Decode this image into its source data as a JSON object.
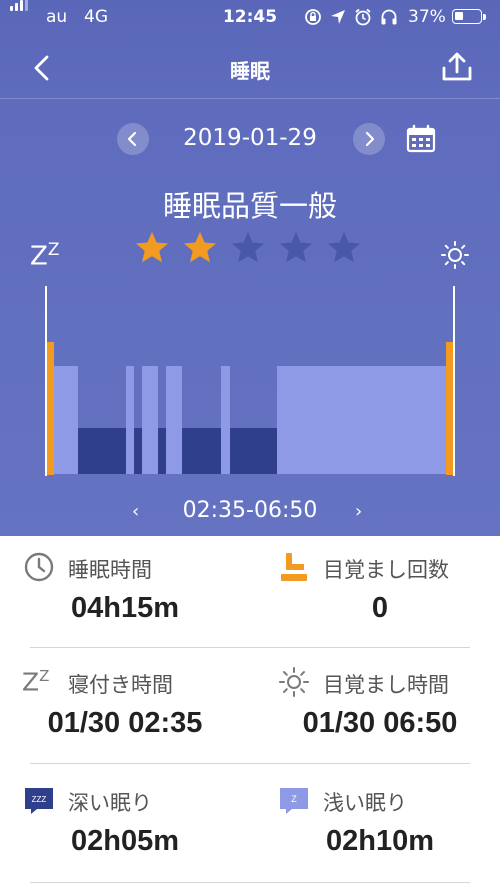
{
  "status_bar": {
    "carrier": "au",
    "network": "4G",
    "time": "12:45",
    "battery_percent": "37%",
    "battery_level": 0.37
  },
  "nav": {
    "title": "睡眠"
  },
  "date_bar": {
    "date": "2019-01-29"
  },
  "quality": {
    "text": "睡眠品質一般",
    "stars_filled": 2,
    "stars_total": 5
  },
  "sleep_chart": {
    "range_label": "02:35-06:50",
    "colors": {
      "awake_marker": "#f29a22",
      "light": "#8e9ae6",
      "deep": "#2f3f8c",
      "background": "#6573c2"
    }
  },
  "stats": {
    "sleep_time": {
      "label": "睡眠時間",
      "value": "04h15m"
    },
    "wake_count": {
      "label": "目覚まし回数",
      "value": "0"
    },
    "sleep_onset": {
      "label": "寝付き時間",
      "value": "01/30 02:35"
    },
    "wake_time": {
      "label": "目覚まし時間",
      "value": "01/30 06:50"
    },
    "deep_sleep": {
      "label": "深い眠り",
      "value": "02h05m"
    },
    "light_sleep": {
      "label": "浅い眠り",
      "value": "02h10m"
    }
  },
  "icons": {
    "deep_icon_text": "ZZZ",
    "light_icon_text": "Z"
  }
}
